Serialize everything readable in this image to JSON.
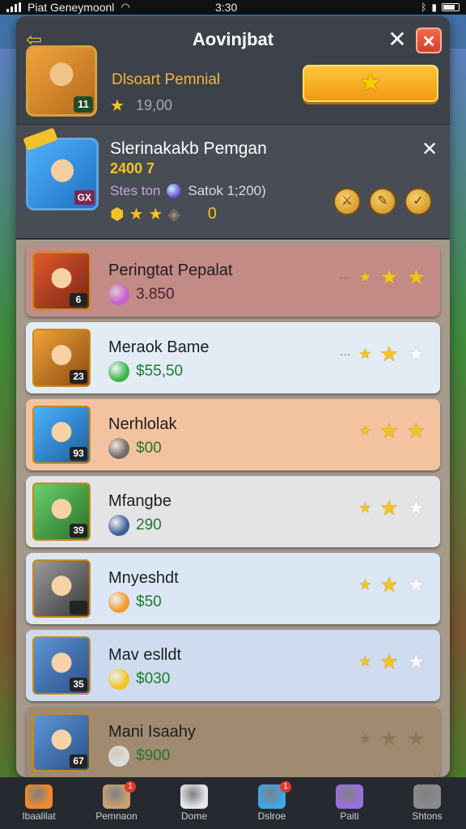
{
  "status_bar": {
    "carrier": "Piat Geneymoonl",
    "time": "3:30"
  },
  "panel": {
    "title": "Aovinjbat",
    "header": {
      "level": "11",
      "name": "Dlsoart Pemnial",
      "score": "19,00"
    },
    "featured": {
      "title": "Slerinakakb Pemgan",
      "badge": "GX",
      "level_text": "2400 7",
      "stat_label": "Stes ton",
      "stat_value": "Satok 1;200)",
      "counter": "0"
    },
    "rows": [
      {
        "name": "Peringtat Pepalat",
        "price": "3.850",
        "lvl": "6",
        "label": "···",
        "bg": "#c38b85",
        "price_color": "#4a1e30",
        "icon_color": "#c45fd1",
        "avatar_a": "#e25b2c",
        "avatar_b": "#7a2418",
        "stars": [
          "full",
          "full"
        ]
      },
      {
        "name": "Meraok Bame",
        "price": "$55,50",
        "lvl": "23",
        "label": "···",
        "bg": "#e3ecf5",
        "price_color": "#1e7a2a",
        "icon_color": "#39b54a",
        "avatar_a": "#f2a23a",
        "avatar_b": "#8a4a12",
        "stars": [
          "full",
          "empty"
        ]
      },
      {
        "name": "Nerhlolak",
        "price": "$00",
        "lvl": "93",
        "label": "",
        "bg": "#f3c3a0",
        "price_color": "#1e7a2a",
        "icon_color": "#6b6b6b",
        "avatar_a": "#4bb3ff",
        "avatar_b": "#1c5e99",
        "stars": [
          "full",
          "full"
        ]
      },
      {
        "name": "Mfangbe",
        "price": "290",
        "lvl": "39",
        "label": "",
        "bg": "#e4e4e7",
        "price_color": "#1e7a2a",
        "icon_color": "#3c5f9a",
        "avatar_a": "#6ad16a",
        "avatar_b": "#2b6e2b",
        "stars": [
          "full",
          "empty"
        ]
      },
      {
        "name": "Mnyeshdt",
        "price": "$50",
        "lvl": "",
        "label": "",
        "bg": "#dbe7f4",
        "price_color": "#1e7a2a",
        "icon_color": "#f2992e",
        "avatar_a": "#9a9a9a",
        "avatar_b": "#3a3a3a",
        "stars": [
          "full",
          "empty"
        ]
      },
      {
        "name": "Mav eslldt",
        "price": "$030",
        "lvl": "35",
        "label": "",
        "bg": "#cfdcf0",
        "price_color": "#1e7a2a",
        "icon_color": "#f3c323",
        "avatar_a": "#5e97d6",
        "avatar_b": "#2a4f88",
        "stars": [
          "full",
          "empty"
        ]
      },
      {
        "name": "Mani Isaahy",
        "price": "$900",
        "lvl": "67",
        "label": "",
        "bg": "#a08a70",
        "price_color": "#1e7a2a",
        "icon_color": "#dcdcdc",
        "avatar_a": "#5e97d6",
        "avatar_b": "#2a4f88",
        "stars": [
          "dim",
          "dim"
        ]
      }
    ]
  },
  "nav": {
    "items": [
      {
        "label": "Ibaalilat",
        "icon": "home-icon",
        "color": "#f08a2a",
        "badge": ""
      },
      {
        "label": "Pemnaon",
        "icon": "shop-icon",
        "color": "#c9a271",
        "badge": "1"
      },
      {
        "label": "Dome",
        "icon": "gear-icon",
        "color": "#e6e6e6",
        "badge": ""
      },
      {
        "label": "Dslroe",
        "icon": "globe-icon",
        "color": "#3fa7e8",
        "badge": "1"
      },
      {
        "label": "Paiti",
        "icon": "orb-icon",
        "color": "#9a6fe0",
        "badge": ""
      },
      {
        "label": "Shtons",
        "icon": "profile-icon",
        "color": "#8a8a8a",
        "badge": ""
      }
    ]
  }
}
